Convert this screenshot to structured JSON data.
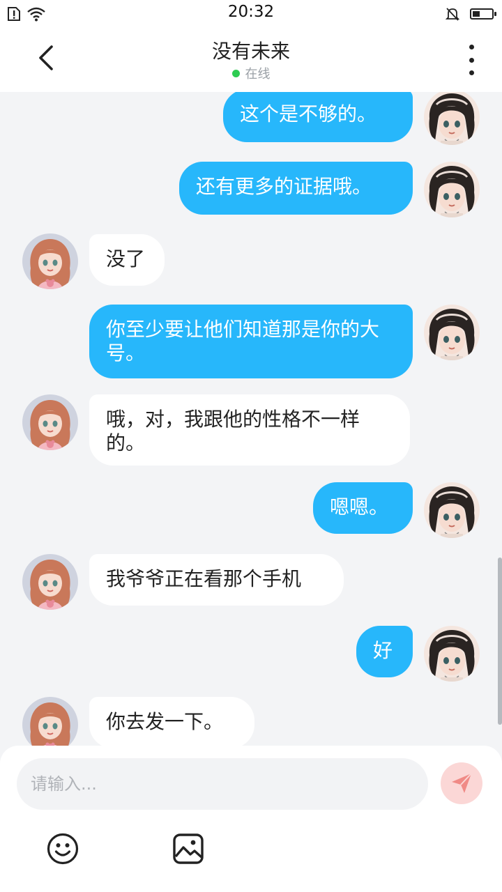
{
  "status_bar": {
    "time": "20:32",
    "battery_level": 0.4
  },
  "header": {
    "title": "没有未来",
    "status": "在线"
  },
  "messages": [
    {
      "side": "out",
      "text": "这个是不够的。"
    },
    {
      "side": "out",
      "text": "还有更多的证据哦。"
    },
    {
      "side": "in",
      "text": "没了"
    },
    {
      "side": "out",
      "text": "你至少要让他们知道那是你的大号。"
    },
    {
      "side": "in",
      "text": "哦，对，我跟他的性格不一样的。"
    },
    {
      "side": "out",
      "text": "嗯嗯。"
    },
    {
      "side": "in",
      "text": "我爷爷正在看那个手机"
    },
    {
      "side": "out",
      "text": "好"
    },
    {
      "side": "in",
      "text": "你去发一下。"
    }
  ],
  "composer": {
    "placeholder": "请输入..."
  },
  "colors": {
    "outgoing_bubble": "#27b7fb",
    "incoming_bubble": "#ffffff",
    "online": "#2ecc52",
    "send_button": "#fbd7d6",
    "send_icon": "#f08a86"
  }
}
